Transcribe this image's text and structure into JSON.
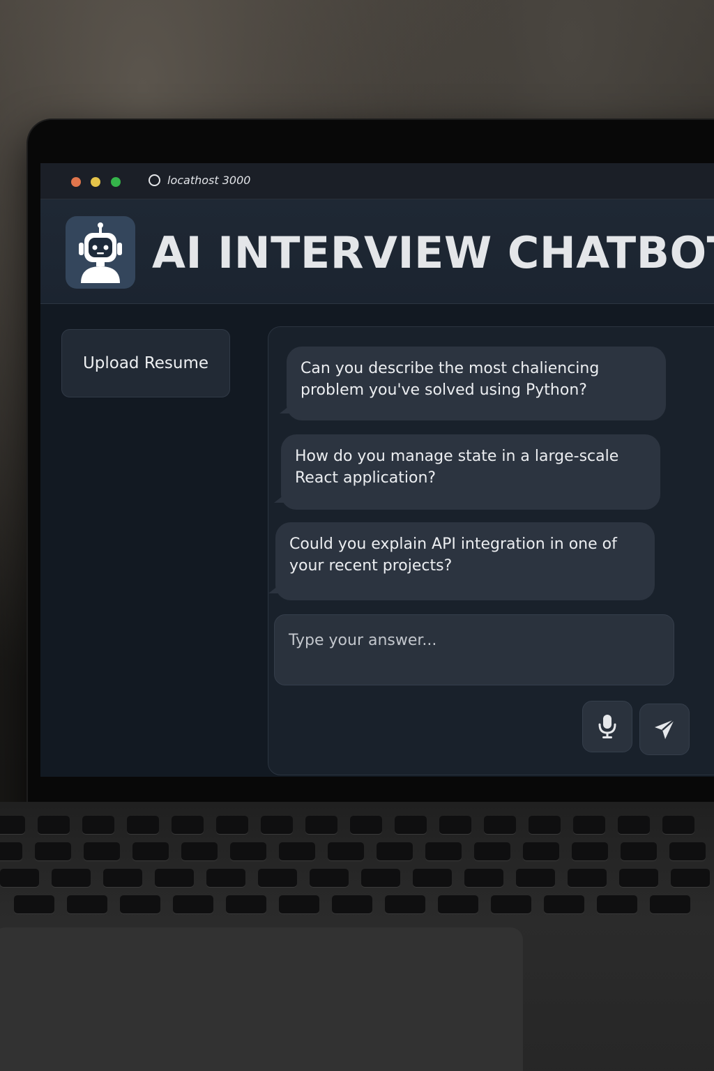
{
  "browser": {
    "url": "locathost 3000",
    "traffic_lights": {
      "close": "#e0754c",
      "minimize": "#e5c44a",
      "zoom": "#35b44a"
    }
  },
  "header": {
    "logo_icon": "robot-icon",
    "title": "AI INTERVIEW CHATBOT"
  },
  "sidebar": {
    "upload_label": "Upload Resume"
  },
  "chat": {
    "messages": [
      "Can you describe the most chaliencing problem you've solved using Python?",
      "How do you manage state in a large-scale React application?",
      "Could you explain API integration in one of your recent projects?"
    ],
    "input_placeholder": "Type your answer...",
    "mic_icon": "microphone-icon",
    "send_icon": "send-icon"
  },
  "colors": {
    "screen_bg": "#121922",
    "panel_bg": "#19212b",
    "bubble_bg": "#2c3440",
    "header_bg": "#1f2834",
    "text": "#eceef1"
  }
}
